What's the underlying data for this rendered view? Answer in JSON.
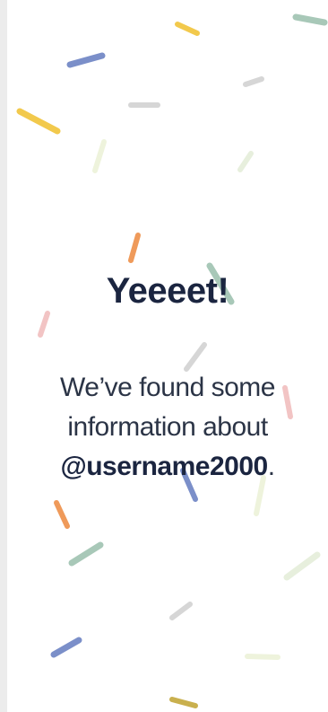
{
  "success": {
    "title": "Yeeeet!",
    "line1": "We’ve found some",
    "line2": "information about",
    "username": "@username2000",
    "suffix": "."
  },
  "colors": {
    "yellow": "#f2c94c",
    "blue": "#7b8fc9",
    "gray": "#d6d6d6",
    "sage": "#a8c8b8",
    "lightgreen": "#eef3dc",
    "orange": "#ef9a5a",
    "pink": "#f2c4c4",
    "text": "#1b2540"
  }
}
